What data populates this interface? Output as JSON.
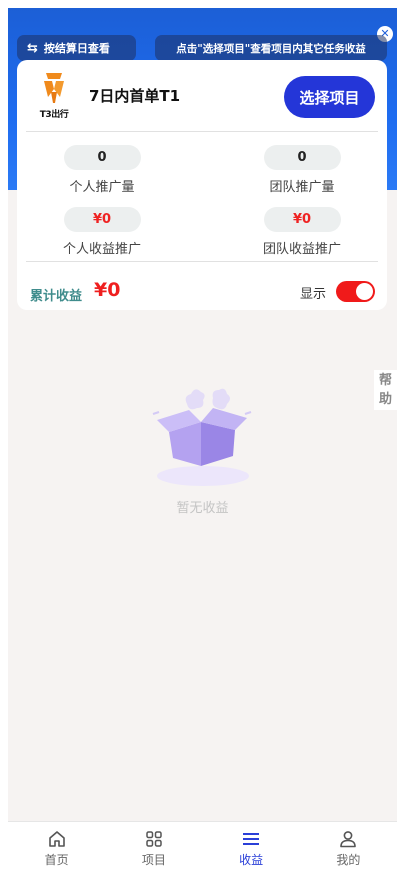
{
  "header": {
    "settle_label": "按结算日查看",
    "hint": "点击\"选择项目\"查看项目内其它任务收益"
  },
  "project": {
    "logo_text": "T3出行",
    "name": "7日内首单T1",
    "select_label": "选择项目"
  },
  "stats": [
    {
      "value": "0",
      "label": "个人推广量"
    },
    {
      "value": "0",
      "label": "团队推广量"
    },
    {
      "value": "¥0",
      "label": "个人收益推广"
    },
    {
      "value": "¥0",
      "label": "团队收益推广"
    }
  ],
  "total": {
    "label": "累计收益",
    "value": "¥0",
    "show_label": "显示",
    "show_enabled": true
  },
  "help_label": "帮助",
  "empty_text": "暂无收益",
  "tabs": [
    {
      "label": "首页",
      "icon": "home-icon"
    },
    {
      "label": "项目",
      "icon": "grid-icon"
    },
    {
      "label": "收益",
      "icon": "menu-icon"
    },
    {
      "label": "我的",
      "icon": "user-icon"
    }
  ],
  "colors": {
    "header_blue": "#1e6cf0",
    "select_button": "#2436d8",
    "money_red": "#ef1f1f",
    "total_label": "#3f8c8c",
    "active_tab": "#2a3fd8"
  }
}
